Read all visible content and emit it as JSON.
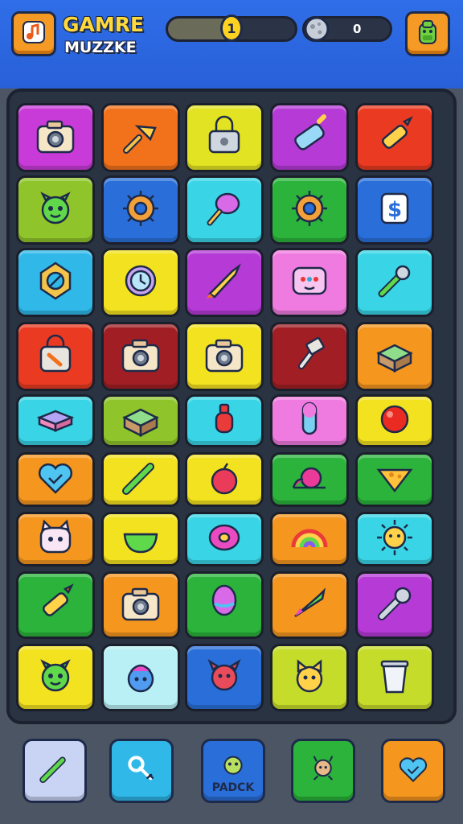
{
  "header": {
    "logo_line1": "GAMRE",
    "logo_line2": "MUZZKE",
    "level_number": "1",
    "level_progress": 0.45,
    "moon_count": "0",
    "colors": {
      "header_bg": "#2f6ee8",
      "button_orange": "#f59a24",
      "coin": "#ffd21f"
    }
  },
  "board": {
    "rows": [
      [
        {
          "color": "#c93bd9",
          "icon": "camera-icon"
        },
        {
          "color": "#f2721b",
          "icon": "brush-icon"
        },
        {
          "color": "#e2e322",
          "icon": "padlock-icon"
        },
        {
          "color": "#b53ad6",
          "icon": "battery-icon"
        },
        {
          "color": "#ea3b22",
          "icon": "crayon-icon"
        }
      ],
      [
        {
          "color": "#8fc42b",
          "icon": "green-monster-icon"
        },
        {
          "color": "#2a6fd9",
          "icon": "gear-icon"
        },
        {
          "color": "#39d5e6",
          "icon": "magnifier-icon"
        },
        {
          "color": "#2bb33b",
          "icon": "gear-icon"
        },
        {
          "color": "#2a6fd9",
          "icon": "dollar-icon"
        }
      ],
      [
        {
          "color": "#2fb8e8",
          "icon": "compass-icon"
        },
        {
          "color": "#f3e21f",
          "icon": "clock-icon"
        },
        {
          "color": "#b53ad6",
          "icon": "rocket-icon"
        },
        {
          "color": "#f07be0",
          "icon": "robot-face-icon"
        },
        {
          "color": "#39d5e6",
          "icon": "wrench-icon"
        }
      ],
      [
        {
          "color": "#ea3b22",
          "icon": "bag-icon"
        },
        {
          "color": "#a11f24",
          "icon": "camera-icon"
        },
        {
          "color": "#f3e21f",
          "icon": "camera-icon"
        },
        {
          "color": "#a11f24",
          "icon": "hammer-icon"
        },
        {
          "color": "#f5961e",
          "icon": "box-icon"
        }
      ],
      [
        {
          "color": "#39d5e6",
          "icon": "book-icon"
        },
        {
          "color": "#8fc42b",
          "icon": "box-icon"
        },
        {
          "color": "#39d5e6",
          "icon": "potion-icon"
        },
        {
          "color": "#f07be0",
          "icon": "capsule-icon"
        },
        {
          "color": "#f3e21f",
          "icon": "ball-icon"
        }
      ],
      [
        {
          "color": "#f5961e",
          "icon": "heart-icon"
        },
        {
          "color": "#f3e21f",
          "icon": "pencil-icon"
        },
        {
          "color": "#f3e21f",
          "icon": "apple-icon"
        },
        {
          "color": "#2bb33b",
          "icon": "snail-icon"
        },
        {
          "color": "#2bb33b",
          "icon": "cheese-icon"
        }
      ],
      [
        {
          "color": "#f5961e",
          "icon": "cat-icon"
        },
        {
          "color": "#f3e21f",
          "icon": "bowl-icon"
        },
        {
          "color": "#39d5e6",
          "icon": "donut-icon"
        },
        {
          "color": "#f5961e",
          "icon": "rainbow-icon"
        },
        {
          "color": "#39d5e6",
          "icon": "sun-icon"
        }
      ],
      [
        {
          "color": "#2bb33b",
          "icon": "crayon-icon"
        },
        {
          "color": "#f5961e",
          "icon": "camera-icon"
        },
        {
          "color": "#2bb33b",
          "icon": "balloon-icon"
        },
        {
          "color": "#f5961e",
          "icon": "carrot-icon"
        },
        {
          "color": "#b53ad6",
          "icon": "robot-arm-icon"
        }
      ],
      [
        {
          "color": "#f3e21f",
          "icon": "green-monster-icon"
        },
        {
          "color": "#b8f0f5",
          "icon": "blue-monster-icon"
        },
        {
          "color": "#2a6fd9",
          "icon": "red-devil-icon"
        },
        {
          "color": "#c6dc2a",
          "icon": "cat-face-icon"
        },
        {
          "color": "#c6dc2a",
          "icon": "cup-icon"
        }
      ]
    ]
  },
  "bottom": {
    "buttons": [
      {
        "color": "#c9d4f4",
        "icon": "pencil-icon",
        "label": ""
      },
      {
        "color": "#2fb8e8",
        "icon": "key-icon",
        "label": ""
      },
      {
        "color": "#2a6fd9",
        "icon": "monster-icon",
        "label": "PADCK"
      },
      {
        "color": "#2bb33b",
        "icon": "deer-icon",
        "label": ""
      },
      {
        "color": "#f5961e",
        "icon": "heart-icon",
        "label": ""
      }
    ]
  }
}
